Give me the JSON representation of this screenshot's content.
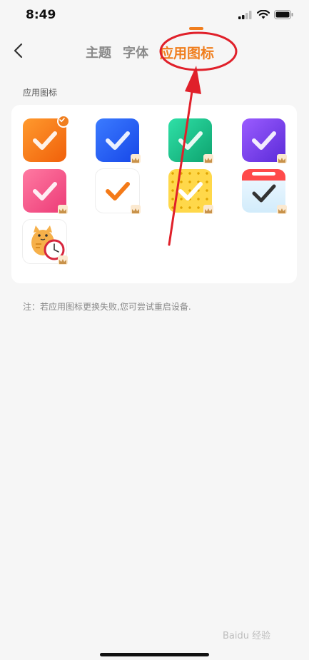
{
  "status_bar": {
    "time": "8:49"
  },
  "nav": {
    "tabs": [
      {
        "label": "主题"
      },
      {
        "label": "字体"
      },
      {
        "label": "应用图标"
      }
    ],
    "active_tab": "应用图标"
  },
  "section": {
    "title": "应用图标"
  },
  "icons": [
    {
      "name": "orange-check",
      "selected": true,
      "premium": false,
      "colors": [
        "#ff9a2e",
        "#f0600a"
      ]
    },
    {
      "name": "blue-check",
      "selected": false,
      "premium": true,
      "colors": [
        "#3b7bff",
        "#1747e8"
      ]
    },
    {
      "name": "green-check",
      "selected": false,
      "premium": true,
      "colors": [
        "#2fe0a7",
        "#0ea36f"
      ]
    },
    {
      "name": "purple-check",
      "selected": false,
      "premium": true,
      "colors": [
        "#9b5cff",
        "#5b2bd8"
      ]
    },
    {
      "name": "pink-check",
      "selected": false,
      "premium": true,
      "colors": [
        "#ff7aa2",
        "#ec3b77"
      ]
    },
    {
      "name": "white-orange-check",
      "selected": false,
      "premium": true,
      "colors": [
        "#ffffff",
        "#ffffff"
      ]
    },
    {
      "name": "biscuit-check",
      "selected": false,
      "premium": true,
      "colors": [
        "#ffd84a",
        "#f4c126"
      ]
    },
    {
      "name": "calendar-snow-check",
      "selected": false,
      "premium": true,
      "colors": [
        "#e9f6ff",
        "#d2ecfb"
      ]
    },
    {
      "name": "cat-clock",
      "selected": false,
      "premium": true,
      "colors": [
        "#ffffff",
        "#ffffff"
      ]
    }
  ],
  "note": "注：若应用图标更换失败,您可尝试重启设备.",
  "watermark": "Baidu 经验",
  "accent_color": "#f07e1e",
  "annotation_color": "#e0202a"
}
